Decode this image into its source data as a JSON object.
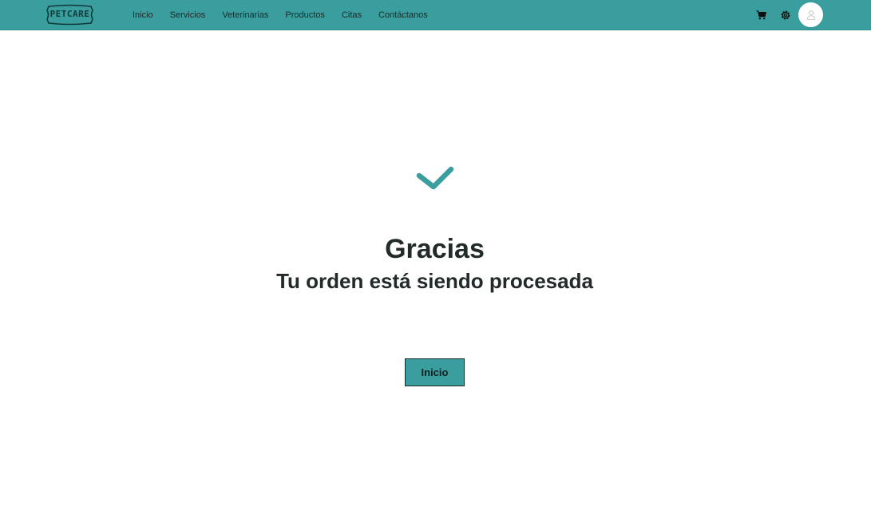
{
  "brand": {
    "logo_text": "PETCARE",
    "accent_color": "#3a9e9e"
  },
  "nav": {
    "links": [
      "Inicio",
      "Servicios",
      "Veterinarias",
      "Productos",
      "Citas",
      "Contáctanos"
    ]
  },
  "icons": {
    "cart": "shopping-cart-icon",
    "settings": "gear-icon",
    "profile": "user-icon",
    "status": "checkmark-icon"
  },
  "confirmation": {
    "title": "Gracias",
    "subtitle": "Tu orden está siendo procesada",
    "button_label": "Inicio"
  }
}
